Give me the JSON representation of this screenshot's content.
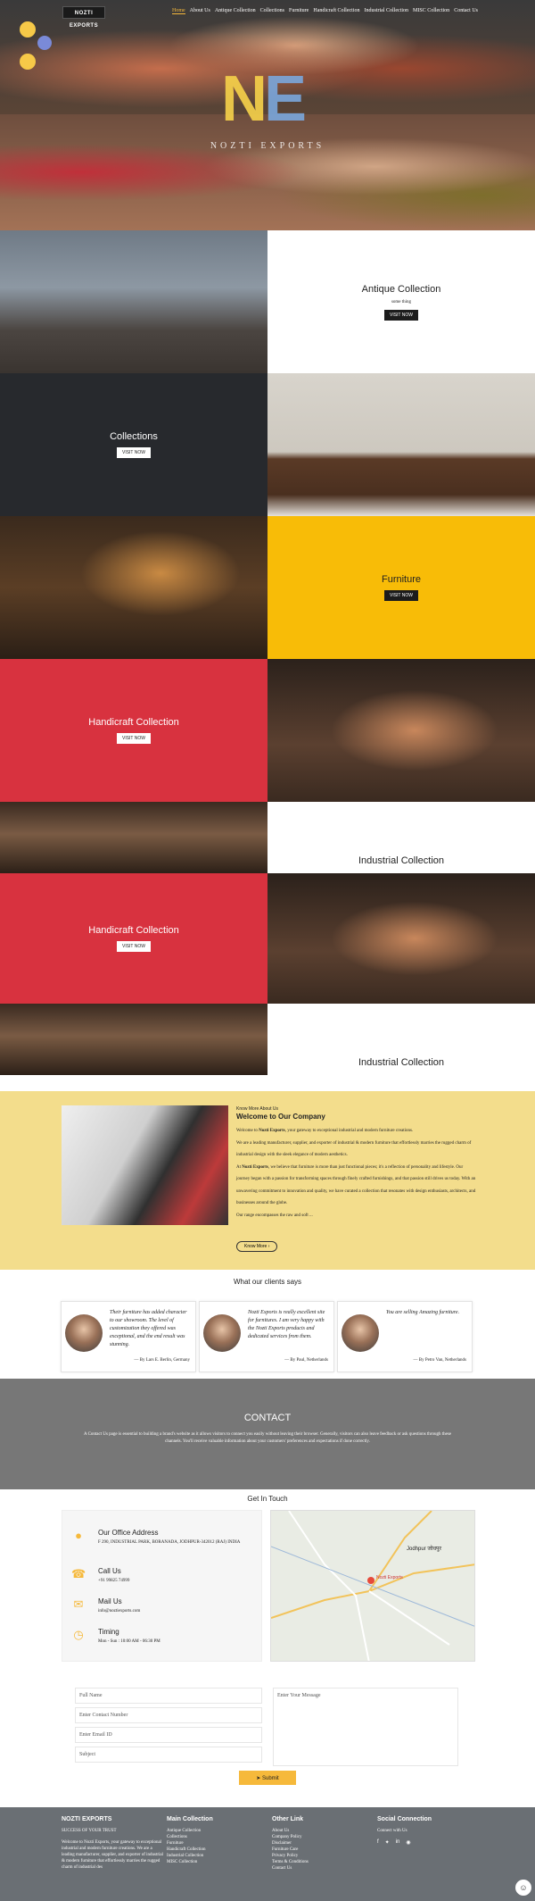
{
  "brand": {
    "logo_text": "NOZTI EXPORTS",
    "tagline": "NOZTI EXPORTS"
  },
  "nav": [
    "Home",
    "About Us",
    "Antique Collection",
    "Collections",
    "Furniture",
    "Handicraft Collection",
    "Industrial Collection",
    "MISC Collection",
    "Contact Us"
  ],
  "tiles": {
    "antique": {
      "title": "Antique Collection",
      "sub": "some thing",
      "button": "VISIT NOW"
    },
    "collections": {
      "title": "Collections",
      "button": "VISIT NOW"
    },
    "furniture": {
      "title": "Furniture",
      "button": "VISIT NOW"
    },
    "handicraft1": {
      "title": "Handicraft Collection",
      "button": "VISIT NOW"
    },
    "industrial1": {
      "title": "Industrial Collection"
    },
    "handicraft2": {
      "title": "Handicraft Collection",
      "button": "VISIT NOW"
    },
    "industrial2": {
      "title": "Industrial Collection"
    }
  },
  "about": {
    "kicker": "Know More About Us",
    "title": "Welcome to Our Company",
    "p1_prefix": "Welcome to ",
    "p1_bold": "Nozti Exports",
    "p1_suffix": ", your gateway to exceptional industrial and modern furniture creations.",
    "p2": "We are a leading manufacturer, supplier, and exporter of industrial & modern furniture that effortlessly marries the rugged charm of industrial design with the sleek elegance of modern aesthetics.",
    "p3_prefix": "At ",
    "p3_bold": "Nozti Exports",
    "p3_suffix": ", we believe that furniture is more than just functional pieces; it's a reflection of personality and lifestyle. Our journey began with a passion for transforming spaces through finely crafted furnishings, and that passion still drives us today. With an unwavering commitment to innovation and quality, we have curated a collection that resonates with design enthusiasts, architects, and businesses around the globe.",
    "p4": "Our range encompasses the raw and soft ...",
    "button": "Know More"
  },
  "testimonials": {
    "title": "What our clients says",
    "items": [
      {
        "quote": "Their furniture has added character to our showroom. The level of customization they offered was exceptional, and the end result was stunning.",
        "by": "— By Lars E. Berlin, Germany"
      },
      {
        "quote": "Nozti Exports is really excellent site for furnitures. I am very happy with the Nozti Exports products and dedicated services from them.",
        "by": "— By Paul, Netherlands"
      },
      {
        "quote": "You are selling Amazing furniture.",
        "by": "— By Petro Van, Netherlands"
      }
    ]
  },
  "contact_band": {
    "title": "CONTACT",
    "text": "A Contact Us page is essential to building a brand's website as it allows visitors to connect you easily without leaving their browser. Generally, visitors can also leave feedback or ask questions through these channels. You'll receive valuable information about your customers' preferences and expectations if done correctly."
  },
  "get_in_touch": {
    "title": "Get In Touch",
    "address_title": "Our Office Address",
    "address": "F 290, INDUSTRIAL PARK, BORANADA, JODHPUR-342012 (RAJ) INDIA",
    "call_title": "Call Us",
    "call": "+91 99825 74999",
    "mail_title": "Mail Us",
    "mail": "info@noztiexports.com",
    "timing_title": "Timing",
    "timing": "Mon - Sun : 10:00 AM - 06:30 PM",
    "map_labels": [
      "Jodhpur जोधपुर",
      "Nozti Exports"
    ]
  },
  "form": {
    "full_name": "Full Name",
    "contact": "Enter Contact Number",
    "email": "Enter Email ID",
    "subject": "Subject",
    "message": "Enter Your Message",
    "submit": "Submit"
  },
  "footer": {
    "col1_title": "NOZTI EXPORTS",
    "col1_sub": "SUCCESS OF YOUR TRUST",
    "col1_text": "Welcome to Nozti Exports, your gateway to exceptional industrial and modern furniture creations. We are a leading manufacturer, supplier, and exporter of industrial & modern furniture that effortlessly marries the rugged charm of industrial des",
    "col2_title": "Main Collection",
    "col2_links": [
      "Antique Collection",
      "Collections",
      "Furniture",
      "Handicraft Collection",
      "Industrial Collection",
      "MISC Collection"
    ],
    "col3_title": "Other Link",
    "col3_links": [
      "About Us",
      "Company Policy",
      "Disclaimer",
      "Furniture Care",
      "Privacy Policy",
      "Terms & Conditions",
      "Contact Us"
    ],
    "col4_title": "Social Connection",
    "col4_sub": "Connect with Us"
  },
  "colors": {
    "accent": "#f6b93b",
    "red": "#d8323f",
    "yellow": "#f8bc07",
    "dark": "#27292d",
    "about_bg": "#f3dd8c",
    "contact_bg": "#777777",
    "footer_bg": "#6a6f74"
  }
}
